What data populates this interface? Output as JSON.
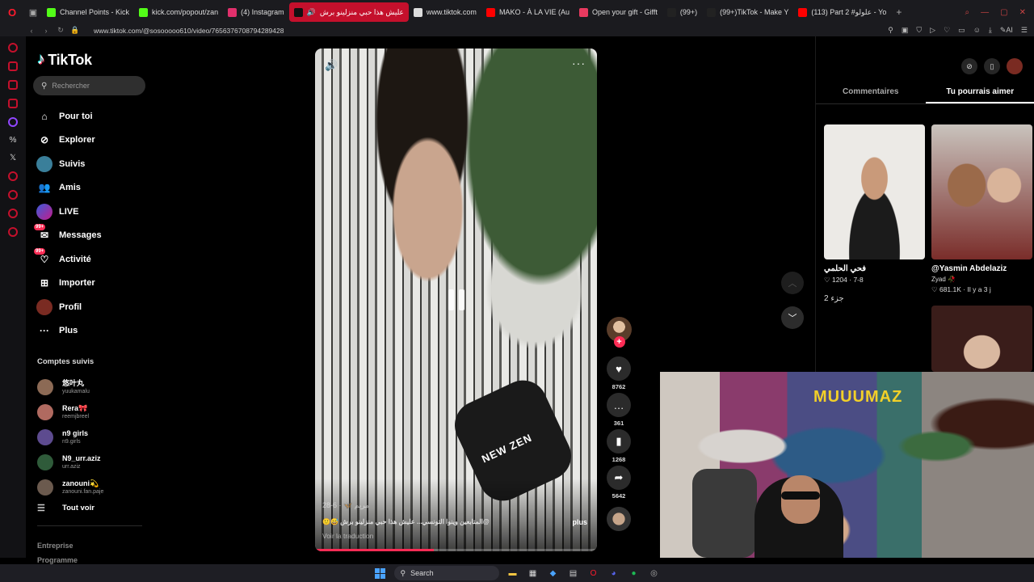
{
  "browser": {
    "tabs": [
      {
        "label": "Channel Points - Kick",
        "color": "#53fc18",
        "active": false
      },
      {
        "label": "kick.com/popout/zan",
        "color": "#53fc18",
        "active": false
      },
      {
        "label": "(4) Instagram",
        "color": "#e1306c",
        "active": false
      },
      {
        "label": "عليش هذا حبي منزلينو برش",
        "color": "#ffffff",
        "active": true
      },
      {
        "label": "www.tiktok.com",
        "color": "#dddddd",
        "active": false
      },
      {
        "label": "MAKO - À LA VIE (Au",
        "color": "#ff0000",
        "active": false
      },
      {
        "label": "Open your gift - Gifft",
        "color": "#e83a5f",
        "active": false
      },
      {
        "label": "(99+)",
        "color": "#ffffff",
        "active": false
      },
      {
        "label": "(99+)TikTok - Make Y",
        "color": "#ffffff",
        "active": false
      },
      {
        "label": "(113) Part 2 #علولو - Yo",
        "color": "#ff0000",
        "active": false
      }
    ],
    "url": "www.tiktok.com/@sosooooo610/video/7656376708794289428"
  },
  "sidebar": {
    "brand": "TikTok",
    "search_placeholder": "Rechercher",
    "nav": [
      {
        "label": "Pour toi",
        "icon": "home-icon"
      },
      {
        "label": "Explorer",
        "icon": "compass-icon"
      },
      {
        "label": "Suivis",
        "icon": "following-icon"
      },
      {
        "label": "Amis",
        "icon": "friends-icon"
      },
      {
        "label": "LIVE",
        "icon": "live-icon"
      },
      {
        "label": "Messages",
        "icon": "messages-icon",
        "badge": "99+"
      },
      {
        "label": "Activité",
        "icon": "activity-icon",
        "badge": "99+"
      },
      {
        "label": "Importer",
        "icon": "upload-icon"
      },
      {
        "label": "Profil",
        "icon": "profile-icon"
      },
      {
        "label": "Plus",
        "icon": "more-icon"
      }
    ],
    "following_title": "Comptes suivis",
    "following": [
      {
        "name": "悠叶丸",
        "handle": "yuukamalu",
        "color": "#8c6a55"
      },
      {
        "name": "Rera🎀",
        "handle": "reemjbreel",
        "color": "#b06a60"
      },
      {
        "name": "n9 girls",
        "handle": "n9.girls",
        "color": "#5d4b8f"
      },
      {
        "name": "N9_urr.aziz",
        "handle": "urr.aziz",
        "color": "#2f5b3a"
      },
      {
        "name": "zanouni💫",
        "handle": "zanouni.fan.paje",
        "color": "#6b5a4e"
      }
    ],
    "see_all": "Tout voir",
    "footer": [
      "Entreprise",
      "Programme"
    ]
  },
  "video": {
    "author": "مريم 🦋 · 6-28",
    "caption": "@المتابعين وينوا التونسي... عليش هذا حبي منزلينو برش 😅🙂",
    "more_label": "plus",
    "translate_label": "Voir la traduction",
    "mic_text": "NEW ZEN",
    "progress": 0.42
  },
  "actions": {
    "likes": "8762",
    "comments": "361",
    "saves": "1268",
    "shares": "5642"
  },
  "right_panel": {
    "tabs": [
      "Commentaires",
      "Tu pourrais aimer"
    ],
    "active_tab": 1,
    "suggestions": [
      {
        "handle": "فحي الحلمي",
        "sub": "",
        "stats": "♡ 1204 · 7-8",
        "extra": "جزء 2"
      },
      {
        "handle": "@Yasmin Abdelaziz",
        "sub": "Zyad 🥀",
        "stats": "♡ 681.1K · Il y a 3 j",
        "extra": ""
      }
    ]
  },
  "webcam": {
    "graffiti": "MUUUMAZ"
  },
  "taskbar": {
    "search_label": "Search"
  }
}
